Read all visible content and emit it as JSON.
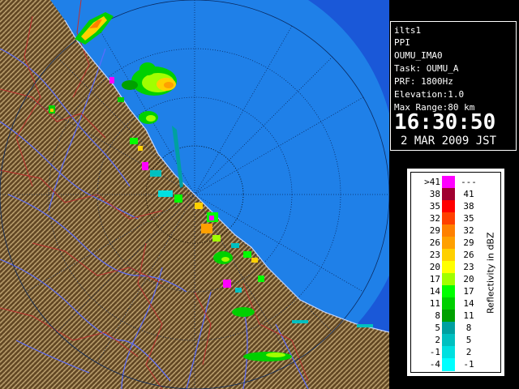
{
  "info": {
    "station": "ilts1",
    "product": "PPI",
    "task_id": "OUMU_IMA0",
    "task": "Task: OUMU_A",
    "prf": "PRF: 1800Hz",
    "elevation": "Elevation:1.0",
    "max_range": "Max Range:80 km",
    "time": "16:30:50",
    "date": "2 MAR 2009 JST"
  },
  "legend": {
    "axis_label": "Reflectivity in dBZ",
    "rows": [
      {
        "left": ">41",
        "right": "---",
        "color": "#ff00ff"
      },
      {
        "left": "38",
        "right": "41",
        "color": "#a00030"
      },
      {
        "left": "35",
        "right": "38",
        "color": "#ff0000"
      },
      {
        "left": "32",
        "right": "35",
        "color": "#ff4000"
      },
      {
        "left": "29",
        "right": "32",
        "color": "#ff8000"
      },
      {
        "left": "26",
        "right": "29",
        "color": "#ffa000"
      },
      {
        "left": "23",
        "right": "26",
        "color": "#ffd000"
      },
      {
        "left": "20",
        "right": "23",
        "color": "#ffff00"
      },
      {
        "left": "17",
        "right": "20",
        "color": "#a0ff00"
      },
      {
        "left": "14",
        "right": "17",
        "color": "#00ff00"
      },
      {
        "left": "11",
        "right": "14",
        "color": "#00d000"
      },
      {
        "left": "8",
        "right": "11",
        "color": "#00a000"
      },
      {
        "left": "5",
        "right": "8",
        "color": "#00a0a0"
      },
      {
        "left": "2",
        "right": "5",
        "color": "#00c0c0"
      },
      {
        "left": "-1",
        "right": "2",
        "color": "#00e0e0"
      },
      {
        "left": "-4",
        "right": "-1",
        "color": "#00ffff"
      }
    ]
  },
  "colors": {
    "sea": "#1e7fe6",
    "sea_outside": "#1a5fcc",
    "land": "#8a6a3a",
    "rivers": "#5a6cff",
    "borders": "#c03030",
    "range_rings": "#000000"
  }
}
